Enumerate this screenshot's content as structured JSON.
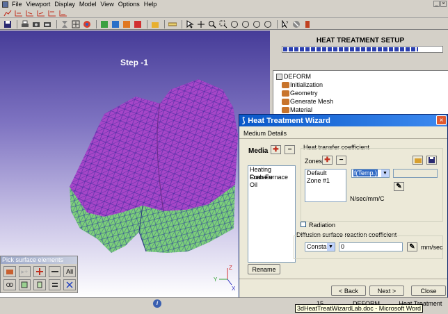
{
  "menu": {
    "items": [
      "File",
      "Viewport",
      "Display",
      "Model",
      "View",
      "Options",
      "Help"
    ]
  },
  "window_controls": {
    "minimize": "_",
    "maximize": "□",
    "close": "×"
  },
  "viewport": {
    "step_label": "Step  -1",
    "axis": {
      "x": "X",
      "y": "Y",
      "z": "Z"
    }
  },
  "pick_palette": {
    "title": "Pick surface elements",
    "buttons_row1": [
      "folder-icon",
      "dot-plus-icon",
      "plus-icon",
      "minus-icon",
      "All"
    ],
    "buttons_row2": [
      "chain-icon",
      "square-icon",
      "shape-icon",
      "rows-icon",
      "x-icon"
    ],
    "all_label": "All"
  },
  "right_panel": {
    "title": "HEAT TREATMENT SETUP",
    "progress_fraction": 0.85,
    "tree": {
      "root": "DEFORM",
      "items": [
        "Initialization",
        "Geometry",
        "Generate Mesh",
        "Material"
      ]
    }
  },
  "dialog": {
    "title": "Heat Treatment Wizard",
    "close": "×",
    "subtitle": "Medium Details",
    "media_label": "Media",
    "media_items": [
      "Heating Furnace",
      "Crab Furnace",
      "Oil"
    ],
    "rename_button": "Rename",
    "htc_group": "Heat transfer coefficient",
    "zones_label": "Zones",
    "zones": [
      "Default",
      "Zone #1"
    ],
    "htc_mode": "f(Temp.)",
    "htc_unit": "N/sec/mm/C",
    "radiation_label": "Radiation",
    "diffusion_group": "Diffusion surface reaction coefficient",
    "diffusion_mode": "Constant",
    "diffusion_value": "0",
    "diffusion_unit": "mm/sec",
    "back_button": "< Back",
    "next_button": "Next >",
    "close_button": "Close"
  },
  "status": {
    "info": "i",
    "texts": [
      "15 msec",
      "DEFORM 3D",
      "Heat Treatment Wizard"
    ],
    "tooltip": "3dHeatTreatWizardLab.doc - Microsoft Word"
  },
  "colors": {
    "mesh_top": "#a646c8",
    "mesh_side": "#7ccf7a",
    "mesh_lines": "#3a2a9a",
    "titlebar": "#0a58c8"
  }
}
